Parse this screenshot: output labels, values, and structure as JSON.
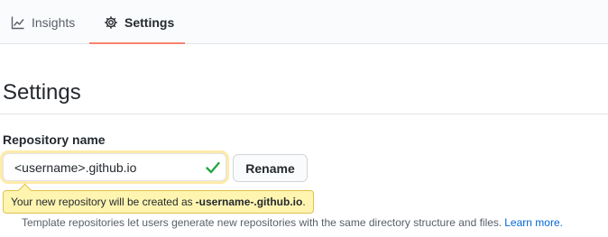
{
  "tabs": {
    "insights": {
      "label": "Insights",
      "icon": "graph-icon"
    },
    "settings": {
      "label": "Settings",
      "icon": "gear-icon",
      "active": true
    }
  },
  "page": {
    "title": "Settings"
  },
  "repository_name": {
    "label": "Repository name",
    "value": "<username>.github.io",
    "valid_icon": "check-icon",
    "rename_label": "Rename"
  },
  "tooltip": {
    "prefix": "Your new repository will be created as",
    "repo_name": "-username-.github.io",
    "suffix": "."
  },
  "template": {
    "help_text": "Template repositories let users generate new repositories with the same directory structure and files.",
    "learn_more": "Learn more."
  },
  "colors": {
    "accent_underline": "#f9826c",
    "link": "#0366d6",
    "valid_check": "#28a745",
    "tooltip_bg": "#fff5b1"
  }
}
